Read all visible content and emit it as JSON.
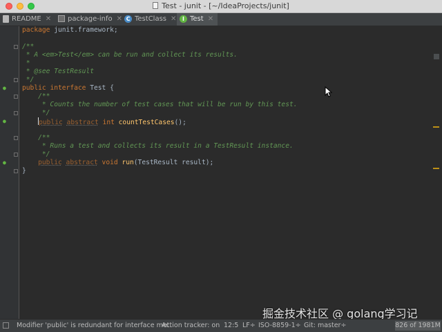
{
  "window": {
    "title": "Test - junit - [~/IdeaProjects/junit]"
  },
  "tabs": [
    {
      "label": "README",
      "icon": "document-icon"
    },
    {
      "label": "package-info",
      "icon": "package-icon"
    },
    {
      "label": "TestClass",
      "icon": "class-icon",
      "icon_letter": "C"
    },
    {
      "label": "Test",
      "icon": "interface-icon",
      "icon_letter": "I",
      "active": true
    }
  ],
  "code": {
    "line1": {
      "kw": "package",
      "rest": " junit.framework;"
    },
    "line3": "/**",
    "line4": " * A <em>Test</em> can be run and collect its results.",
    "line5": " *",
    "line6": " * @see TestResult",
    "line7": " */",
    "line8": {
      "kw1": "public",
      "kw2": "interface",
      "name": "Test",
      "rest": " {"
    },
    "line9": "    /**",
    "line10": "     * Counts the number of test cases that will be run by this test.",
    "line11": "     */",
    "line12": {
      "indent": "    ",
      "kw1": "public",
      "kw2": "abstract",
      "type": "int",
      "fn": "countTestCases",
      "rest": "();"
    },
    "line14": "    /**",
    "line15": "     * Runs a test and collects its result in a TestResult instance.",
    "line16": "     */",
    "line17": {
      "indent": "    ",
      "kw1": "public",
      "kw2": "abstract",
      "type": "void",
      "fn": "run",
      "rest": "(TestResult result);"
    },
    "line18": "}"
  },
  "gutter_marker": "●",
  "watermark": "掘金技术社区 @ golang学习记",
  "status": {
    "message": "Modifier 'public' is redundant for interface met.",
    "action_tracker": "Action tracker: on",
    "position": "12:5",
    "line_sep": "LF÷",
    "encoding": "ISO-8859-1÷",
    "git": "Git: master÷",
    "memory": "826 of 1981M"
  },
  "colors": {
    "keyword": "#cc7832",
    "comment": "#629755",
    "function": "#ffc66d",
    "text": "#a9b7c6",
    "background": "#2b2b2b"
  }
}
